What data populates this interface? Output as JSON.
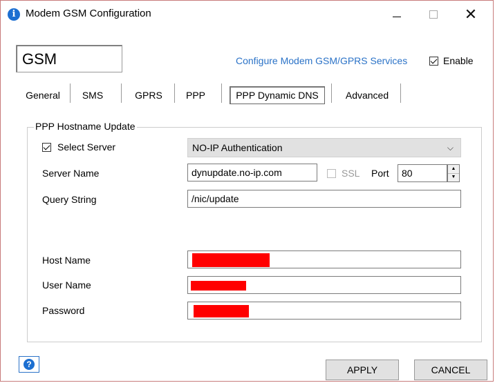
{
  "window": {
    "title": "Modem GSM Configuration",
    "title_icon": "info-icon",
    "accent": "#1c6fd1"
  },
  "header": {
    "name": "GSM",
    "configure_link": "Configure Modem GSM/GPRS Services",
    "enable_label": "Enable",
    "enable_checked": true,
    "link_color": "#2a72c7"
  },
  "tabs": [
    {
      "label": "General",
      "active": false
    },
    {
      "label": "SMS",
      "active": false
    },
    {
      "label": "GPRS",
      "active": false
    },
    {
      "label": "PPP",
      "active": false
    },
    {
      "label": "PPP Dynamic DNS",
      "active": true
    },
    {
      "label": "Advanced",
      "active": false
    }
  ],
  "group": {
    "title": "PPP Hostname Update",
    "select_server_label": "Select Server",
    "select_server_checked": true,
    "server_select_value": "NO-IP Authentication",
    "server_name_label": "Server Name",
    "server_name_value": "dynupdate.no-ip.com",
    "ssl_label": "SSL",
    "ssl_checked": false,
    "port_label": "Port",
    "port_value": "80",
    "query_string_label": "Query String",
    "query_string_value": "/nic/update",
    "host_name_label": "Host Name",
    "user_name_label": "User Name",
    "password_label": "Password",
    "redaction_color": "#ff0000"
  },
  "footer": {
    "apply_label": "APPLY",
    "cancel_label": "CANCEL",
    "help_icon": "help-icon"
  }
}
